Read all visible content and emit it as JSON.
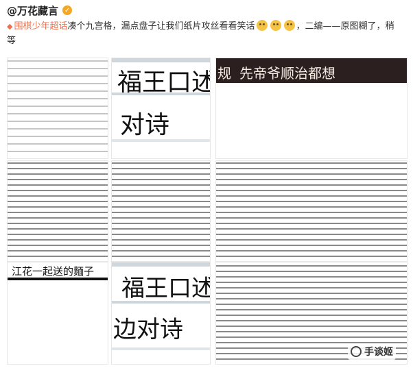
{
  "post": {
    "username": "@万花藏言",
    "verified_icon": "verified-badge-icon",
    "topic": "围棋少年超话",
    "text_after_topic": "凑个九宫格，漏点盘子让我们纸片攻丝看看笑话",
    "emoji_count": 3,
    "text_tail_line1": "，二编——原图糊了，稍",
    "text_tail_line2": "等"
  },
  "grid": {
    "tile2_line1": "福王口述妖",
    "tile2_line2": "对诗",
    "tile3_left": "规",
    "tile3_text": "先帝爷顺治都想",
    "tile7_caption": "江花一起送的麵子",
    "tile8_line1": "福王口述",
    "tile8_line2": "边对诗",
    "watermark_text": "手谈姬"
  }
}
